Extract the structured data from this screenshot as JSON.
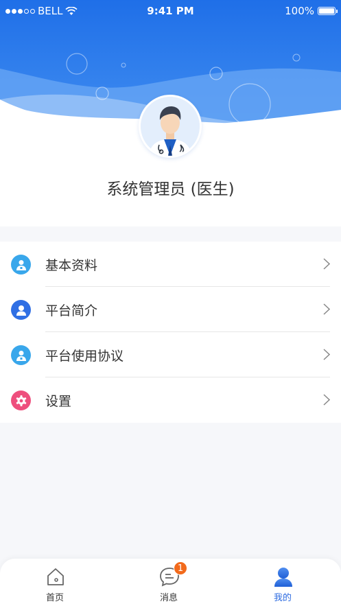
{
  "status_bar": {
    "carrier": "BELL",
    "time": "9:41 PM",
    "battery": "100%"
  },
  "profile": {
    "name": "系统管理员 (医生)"
  },
  "menu": {
    "items": [
      {
        "label": "基本资料",
        "icon": "doctor-profile-icon",
        "color": "#3aa9ec"
      },
      {
        "label": "平台简介",
        "icon": "user-circle-icon",
        "color": "#2f6fe4"
      },
      {
        "label": "平台使用协议",
        "icon": "doctor-agreement-icon",
        "color": "#3aa9ec"
      },
      {
        "label": "设置",
        "icon": "gear-icon",
        "color": "#ef4f7e"
      }
    ]
  },
  "tabbar": {
    "tabs": [
      {
        "label": "首页",
        "icon": "home-icon"
      },
      {
        "label": "消息",
        "icon": "message-icon",
        "badge": "1"
      },
      {
        "label": "我的",
        "icon": "person-icon",
        "active": true
      }
    ]
  },
  "colors": {
    "primary": "#2b6ae0",
    "header_blue": "#2f77e8",
    "badge": "#f26a1b"
  }
}
